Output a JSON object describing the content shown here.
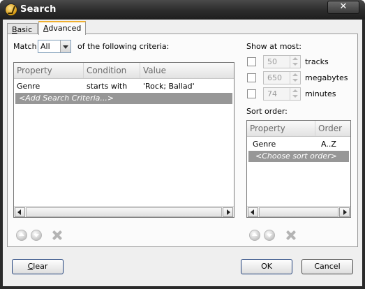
{
  "window": {
    "title": "Search",
    "close_label": "✕"
  },
  "tabs": [
    {
      "label": "Basic",
      "mnemonic": "B",
      "rest": "asic"
    },
    {
      "label": "Advanced",
      "mnemonic": "A",
      "rest": "dvanced"
    }
  ],
  "criteria": {
    "match_label": "Match",
    "match_value": "All",
    "suffix_label": "of the following criteria:",
    "columns": [
      "Property",
      "Condition",
      "Value"
    ],
    "rows": [
      {
        "property": "Genre",
        "condition": "starts with",
        "value": "'Rock; Ballad'"
      }
    ],
    "add_row_label": "<Add Search Criteria...>"
  },
  "limits": {
    "heading": "Show at most:",
    "items": [
      {
        "value": "50",
        "unit": "tracks",
        "checked": false
      },
      {
        "value": "650",
        "unit": "megabytes",
        "checked": false
      },
      {
        "value": "74",
        "unit": "minutes",
        "checked": false
      }
    ]
  },
  "sort": {
    "heading": "Sort order:",
    "columns": [
      "Property",
      "Order"
    ],
    "rows": [
      {
        "property": "Genre",
        "order": "A..Z"
      }
    ],
    "add_row_label": "<Choose sort order>"
  },
  "buttons": {
    "clear": "Clear",
    "clear_mnemonic": "C",
    "clear_rest": "lear",
    "ok": "OK",
    "cancel": "Cancel"
  },
  "icons": {
    "up": "move-up-icon",
    "down": "move-down-icon",
    "delete": "delete-icon"
  }
}
